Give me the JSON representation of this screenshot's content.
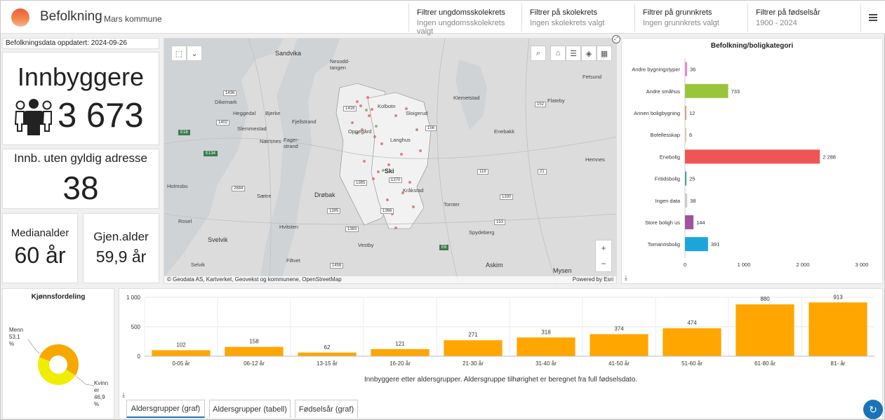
{
  "app": {
    "title": "Befolkning",
    "subtitle": "Mars kommune"
  },
  "filters": [
    {
      "title": "Filtrer ungdomsskolekrets",
      "value": "Ingen ungdomsskolekrets valgt"
    },
    {
      "title": "Filtrer på skolekrets",
      "value": "Ingen skolekrets valgt"
    },
    {
      "title": "Filtrer på grunnkrets",
      "value": "Ingen grunnkrets valgt"
    },
    {
      "title": "Filtrer på fødselsår",
      "value": "1900 - 2024"
    }
  ],
  "updated": "Befolkningsdata oppdatert: 2024-09-26",
  "kpi": {
    "residents_title": "Innbyggere",
    "residents_value": "3 673",
    "no_address_title": "Innb. uten gyldig adresse",
    "no_address_value": "38",
    "median_title": "Medianalder",
    "median_value": "60 år",
    "avg_title": "Gjen.alder",
    "avg_value": "59,9 år"
  },
  "map": {
    "attribution": "Geodata AS, Kartverket, Geovekst og kommunene, OpenStreetMap",
    "powered_by": "Powered by Esri",
    "places": [
      "Sandvika",
      "Nesodd-tangen",
      "Kolbotn",
      "Sloigerud",
      "Dikemark",
      "Heggedal",
      "Bjerke",
      "Fjellstrand",
      "Slemmestad",
      "Nærsnes",
      "Fager-strand",
      "Oppegård",
      "Langhus",
      "Enebakk",
      "Ski",
      "Kråkstad",
      "Drøbak",
      "Sætre",
      "Hvitsten",
      "Svelvik",
      "Tomter",
      "Spydeberg",
      "Vestby",
      "Askim",
      "Mysen",
      "Filtvet",
      "Selvik",
      "Klemetstad",
      "Flateby",
      "Fetsund",
      "Hemnes",
      "Holmsbu",
      "Rosel"
    ],
    "roads": [
      "1436",
      "1416",
      "156",
      "1402",
      "E18",
      "E134",
      "2684",
      "1385",
      "1366",
      "E6",
      "1395",
      "1383",
      "1370",
      "152",
      "21",
      "1330",
      "1456",
      "119",
      "153"
    ],
    "icons": [
      "select-tool-icon",
      "search-icon",
      "home-icon",
      "legend-icon",
      "layers-icon",
      "basemap-gallery-icon",
      "zoom-in-icon",
      "zoom-out-icon"
    ]
  },
  "category_chart": {
    "title": "Befolkning/boligkategori",
    "chart_data": {
      "type": "bar",
      "orientation": "horizontal",
      "categories": [
        "Andre bygningstyper",
        "Andre småhus",
        "Annen boligbygning",
        "Bofellesskap",
        "Enebolig",
        "Fritidsbolig",
        "Ingen data",
        "Store boligh us",
        "Tomannsbolig"
      ],
      "values": [
        36,
        733,
        12,
        6,
        2288,
        25,
        38,
        144,
        391
      ],
      "value_labels": [
        "36",
        "733",
        "12",
        "6",
        "2 288",
        "25",
        "38",
        "144",
        "391"
      ],
      "colors": [
        "#e986d2",
        "#9ac43a",
        "#d9a07a",
        "#d6cfa8",
        "#ee5555",
        "#3faa88",
        "#cccccc",
        "#a053a0",
        "#1ca5d9"
      ],
      "xlim": [
        0,
        3000
      ],
      "xticks": [
        "0",
        "1 000",
        "2 000",
        "3 000"
      ]
    }
  },
  "gender_chart": {
    "title": "Kjønnsfordeling",
    "chart_data": {
      "type": "pie",
      "categories": [
        "Menn",
        "Kvinner"
      ],
      "values": [
        53.1,
        46.9
      ],
      "labels": [
        "Menn 53,1 %",
        "Kvinn er 46,9 %"
      ],
      "colors": [
        "#f6a800",
        "#f0ee00"
      ]
    }
  },
  "age_chart": {
    "caption": "Innbyggere etter aldersgrupper. Aldersgruppe tilhørighet er beregnet fra full fødselsdato.",
    "chart_data": {
      "type": "bar",
      "categories": [
        "0-05 år",
        "06-12 år",
        "13-15 år",
        "16-20 år",
        "21-30 år",
        "31-40 år",
        "41-50 år",
        "51-60 år",
        "61-80 år",
        "81- år"
      ],
      "values": [
        102,
        158,
        62,
        121,
        271,
        318,
        374,
        474,
        880,
        913
      ],
      "ylim": [
        0,
        1000
      ],
      "yticks": [
        "0",
        "500",
        "1 000"
      ],
      "color": "#ffa600"
    },
    "tabs": [
      "Aldersgrupper (graf)",
      "Aldersgrupper (tabell)",
      "Fødselsår (graf)"
    ]
  },
  "colors": {
    "accent": "#1a73b8",
    "bar_orange": "#ffa600"
  }
}
